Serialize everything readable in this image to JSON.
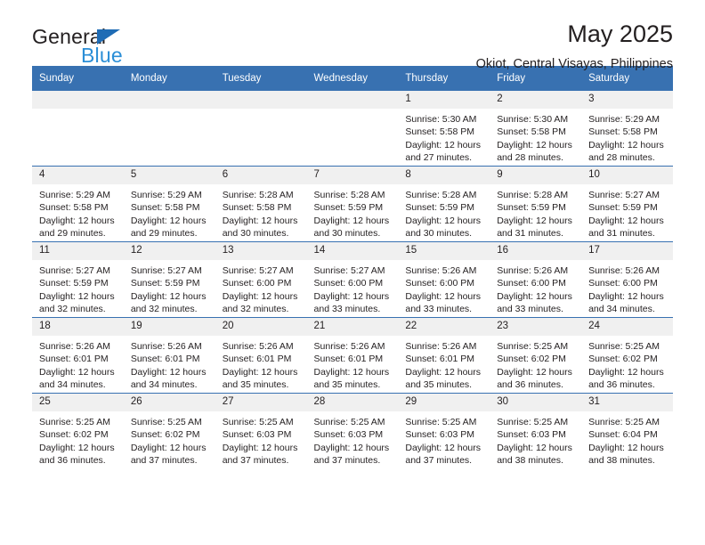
{
  "logo": {
    "text_primary": "General",
    "text_secondary": "Blue",
    "triangle_color": "#1f6cb5",
    "secondary_color": "#2b8ed6"
  },
  "header": {
    "title": "May 2025",
    "subtitle": "Okiot, Central Visayas, Philippines"
  },
  "theme": {
    "header_bar_color": "#3871b1",
    "daynum_bg": "#f0f0f0",
    "text_color": "#231f20"
  },
  "weekday_headers": [
    "Sunday",
    "Monday",
    "Tuesday",
    "Wednesday",
    "Thursday",
    "Friday",
    "Saturday"
  ],
  "weeks": [
    [
      {
        "day": "",
        "lines": []
      },
      {
        "day": "",
        "lines": []
      },
      {
        "day": "",
        "lines": []
      },
      {
        "day": "",
        "lines": []
      },
      {
        "day": "1",
        "lines": [
          "Sunrise: 5:30 AM",
          "Sunset: 5:58 PM",
          "Daylight: 12 hours",
          "and 27 minutes."
        ]
      },
      {
        "day": "2",
        "lines": [
          "Sunrise: 5:30 AM",
          "Sunset: 5:58 PM",
          "Daylight: 12 hours",
          "and 28 minutes."
        ]
      },
      {
        "day": "3",
        "lines": [
          "Sunrise: 5:29 AM",
          "Sunset: 5:58 PM",
          "Daylight: 12 hours",
          "and 28 minutes."
        ]
      }
    ],
    [
      {
        "day": "4",
        "lines": [
          "Sunrise: 5:29 AM",
          "Sunset: 5:58 PM",
          "Daylight: 12 hours",
          "and 29 minutes."
        ]
      },
      {
        "day": "5",
        "lines": [
          "Sunrise: 5:29 AM",
          "Sunset: 5:58 PM",
          "Daylight: 12 hours",
          "and 29 minutes."
        ]
      },
      {
        "day": "6",
        "lines": [
          "Sunrise: 5:28 AM",
          "Sunset: 5:58 PM",
          "Daylight: 12 hours",
          "and 30 minutes."
        ]
      },
      {
        "day": "7",
        "lines": [
          "Sunrise: 5:28 AM",
          "Sunset: 5:59 PM",
          "Daylight: 12 hours",
          "and 30 minutes."
        ]
      },
      {
        "day": "8",
        "lines": [
          "Sunrise: 5:28 AM",
          "Sunset: 5:59 PM",
          "Daylight: 12 hours",
          "and 30 minutes."
        ]
      },
      {
        "day": "9",
        "lines": [
          "Sunrise: 5:28 AM",
          "Sunset: 5:59 PM",
          "Daylight: 12 hours",
          "and 31 minutes."
        ]
      },
      {
        "day": "10",
        "lines": [
          "Sunrise: 5:27 AM",
          "Sunset: 5:59 PM",
          "Daylight: 12 hours",
          "and 31 minutes."
        ]
      }
    ],
    [
      {
        "day": "11",
        "lines": [
          "Sunrise: 5:27 AM",
          "Sunset: 5:59 PM",
          "Daylight: 12 hours",
          "and 32 minutes."
        ]
      },
      {
        "day": "12",
        "lines": [
          "Sunrise: 5:27 AM",
          "Sunset: 5:59 PM",
          "Daylight: 12 hours",
          "and 32 minutes."
        ]
      },
      {
        "day": "13",
        "lines": [
          "Sunrise: 5:27 AM",
          "Sunset: 6:00 PM",
          "Daylight: 12 hours",
          "and 32 minutes."
        ]
      },
      {
        "day": "14",
        "lines": [
          "Sunrise: 5:27 AM",
          "Sunset: 6:00 PM",
          "Daylight: 12 hours",
          "and 33 minutes."
        ]
      },
      {
        "day": "15",
        "lines": [
          "Sunrise: 5:26 AM",
          "Sunset: 6:00 PM",
          "Daylight: 12 hours",
          "and 33 minutes."
        ]
      },
      {
        "day": "16",
        "lines": [
          "Sunrise: 5:26 AM",
          "Sunset: 6:00 PM",
          "Daylight: 12 hours",
          "and 33 minutes."
        ]
      },
      {
        "day": "17",
        "lines": [
          "Sunrise: 5:26 AM",
          "Sunset: 6:00 PM",
          "Daylight: 12 hours",
          "and 34 minutes."
        ]
      }
    ],
    [
      {
        "day": "18",
        "lines": [
          "Sunrise: 5:26 AM",
          "Sunset: 6:01 PM",
          "Daylight: 12 hours",
          "and 34 minutes."
        ]
      },
      {
        "day": "19",
        "lines": [
          "Sunrise: 5:26 AM",
          "Sunset: 6:01 PM",
          "Daylight: 12 hours",
          "and 34 minutes."
        ]
      },
      {
        "day": "20",
        "lines": [
          "Sunrise: 5:26 AM",
          "Sunset: 6:01 PM",
          "Daylight: 12 hours",
          "and 35 minutes."
        ]
      },
      {
        "day": "21",
        "lines": [
          "Sunrise: 5:26 AM",
          "Sunset: 6:01 PM",
          "Daylight: 12 hours",
          "and 35 minutes."
        ]
      },
      {
        "day": "22",
        "lines": [
          "Sunrise: 5:26 AM",
          "Sunset: 6:01 PM",
          "Daylight: 12 hours",
          "and 35 minutes."
        ]
      },
      {
        "day": "23",
        "lines": [
          "Sunrise: 5:25 AM",
          "Sunset: 6:02 PM",
          "Daylight: 12 hours",
          "and 36 minutes."
        ]
      },
      {
        "day": "24",
        "lines": [
          "Sunrise: 5:25 AM",
          "Sunset: 6:02 PM",
          "Daylight: 12 hours",
          "and 36 minutes."
        ]
      }
    ],
    [
      {
        "day": "25",
        "lines": [
          "Sunrise: 5:25 AM",
          "Sunset: 6:02 PM",
          "Daylight: 12 hours",
          "and 36 minutes."
        ]
      },
      {
        "day": "26",
        "lines": [
          "Sunrise: 5:25 AM",
          "Sunset: 6:02 PM",
          "Daylight: 12 hours",
          "and 37 minutes."
        ]
      },
      {
        "day": "27",
        "lines": [
          "Sunrise: 5:25 AM",
          "Sunset: 6:03 PM",
          "Daylight: 12 hours",
          "and 37 minutes."
        ]
      },
      {
        "day": "28",
        "lines": [
          "Sunrise: 5:25 AM",
          "Sunset: 6:03 PM",
          "Daylight: 12 hours",
          "and 37 minutes."
        ]
      },
      {
        "day": "29",
        "lines": [
          "Sunrise: 5:25 AM",
          "Sunset: 6:03 PM",
          "Daylight: 12 hours",
          "and 37 minutes."
        ]
      },
      {
        "day": "30",
        "lines": [
          "Sunrise: 5:25 AM",
          "Sunset: 6:03 PM",
          "Daylight: 12 hours",
          "and 38 minutes."
        ]
      },
      {
        "day": "31",
        "lines": [
          "Sunrise: 5:25 AM",
          "Sunset: 6:04 PM",
          "Daylight: 12 hours",
          "and 38 minutes."
        ]
      }
    ]
  ]
}
